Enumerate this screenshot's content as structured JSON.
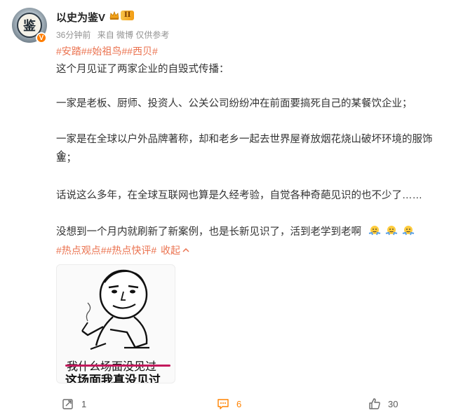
{
  "post": {
    "username": "以史为鉴V",
    "avatar_char": "鉴",
    "verified_badge": "V",
    "level_badge": "II",
    "time": "36分钟前",
    "source": "来自 微博",
    "note": "仅供参考",
    "tags_top": [
      "#安踏#",
      "#始祖鸟#",
      "#西贝#"
    ],
    "paragraphs": [
      "这个月见证了两家企业的自毁式传播：",
      "一家是老板、厨师、投资人、公关公司纷纷冲在前面要搞死自己的某餐饮企业；",
      "一家是在全球以户外品牌著称，却和老乡一起去世界屋脊放烟花烧山破坏环境的服饰企",
      "业；",
      "话说这么多年，在全球互联网也算是久经考验，自觉各种奇葩见识的也不少了……",
      "没想到一个月内就刷新了新案例，也是长新见识了，活到老学到老啊"
    ],
    "tags_bottom": [
      "#热点观点#",
      "#热点快评#"
    ],
    "collapse_label": "收起",
    "meme": {
      "caption_struck": "我什么场面没见过",
      "caption_main": "这场面我真没见过"
    }
  },
  "actions": {
    "repost_count": "1",
    "comment_count": "6",
    "like_count": "30"
  },
  "colors": {
    "accent": "#eb7350",
    "orange": "#ff8200",
    "text": "#333333",
    "meta": "#939393"
  }
}
